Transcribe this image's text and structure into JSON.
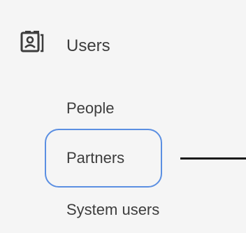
{
  "section": {
    "title": "Users",
    "icon": "contact-card-icon"
  },
  "nav": {
    "items": [
      {
        "label": "People"
      },
      {
        "label": "Partners",
        "highlighted": true
      },
      {
        "label": "System users"
      }
    ]
  },
  "colors": {
    "background": "#f5f5f5",
    "text": "#3d3d3d",
    "highlight": "#5b8fe2",
    "arrow": "#1a1a1a"
  }
}
